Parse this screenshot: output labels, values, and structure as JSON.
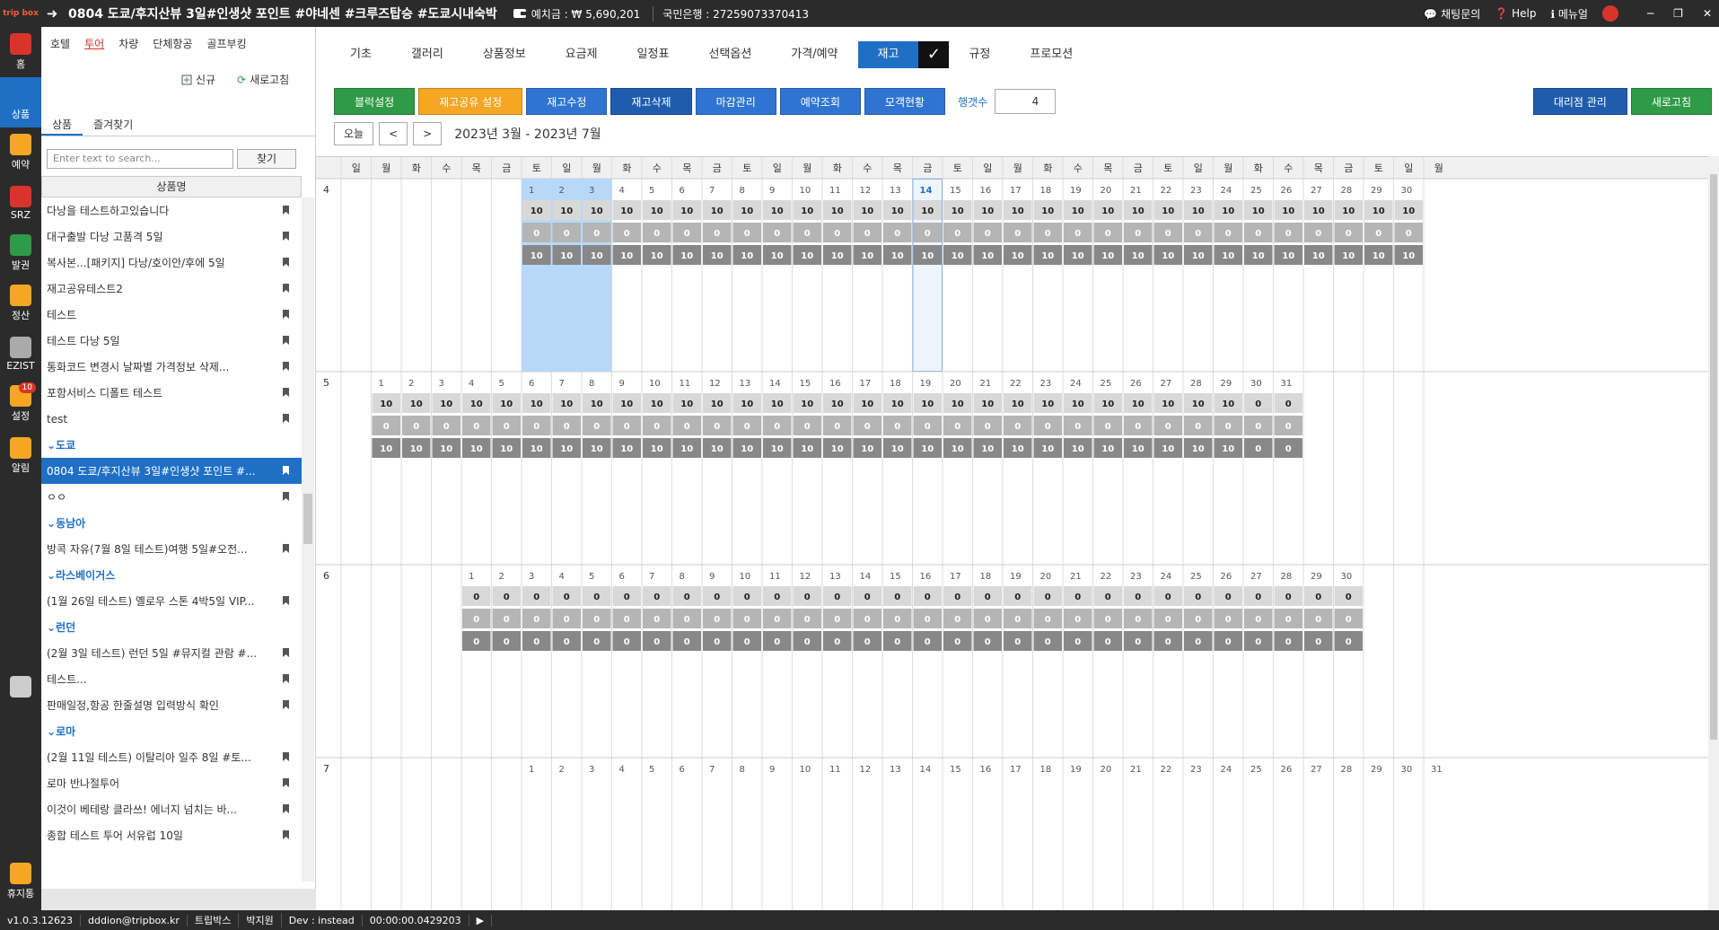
{
  "titlebar": {
    "logo": "trip box",
    "title": "0804 도쿄/후지산뷰 3일#인생샷 포인트 #야네센 #크루즈탑승 #도쿄시내숙박",
    "deposit": "예치금 : ₩ 5,690,201",
    "bank": "국민은행 : 27259073370413",
    "chat": "채팅문의",
    "help": "Help",
    "manual": "메뉴얼"
  },
  "iconbar": [
    {
      "label": "홈",
      "icon": "chart-icon"
    },
    {
      "label": "상품",
      "icon": "globe-icon"
    },
    {
      "label": "예약",
      "icon": "calendar-icon"
    },
    {
      "label": "SRZ",
      "icon": "share-icon"
    },
    {
      "label": "발권",
      "icon": "plane-icon"
    },
    {
      "label": "정산",
      "icon": "wallet-icon"
    },
    {
      "label": "EZIST",
      "icon": "network-icon"
    },
    {
      "label": "설정",
      "icon": "gear-icon",
      "badge": "10"
    },
    {
      "label": "알림",
      "icon": "chat-icon"
    },
    {
      "label": "",
      "icon": "apps-icon"
    },
    {
      "label": "휴지통",
      "icon": "trash-icon"
    }
  ],
  "leftpanel": {
    "tabs": [
      "호텔",
      "투어",
      "차량",
      "단체항공",
      "골프부킹"
    ],
    "new_label": "신규",
    "refresh_label": "새로고침",
    "subtabs": [
      "상품",
      "즐겨찾기"
    ],
    "search_placeholder": "Enter text to search...",
    "search_button": "찾기",
    "list_header": "상품명",
    "items": [
      {
        "type": "item",
        "text": "다낭을 테스트하고있습니다"
      },
      {
        "type": "item",
        "text": "대구출발 다낭 고품격 5일"
      },
      {
        "type": "item",
        "text": "복사본...[패키지] 다낭/호이안/후에 5일"
      },
      {
        "type": "item",
        "text": "재고공유테스트2"
      },
      {
        "type": "item",
        "text": "테스트"
      },
      {
        "type": "item",
        "text": "테스트 다낭 5일"
      },
      {
        "type": "item",
        "text": "통화코드 변경시 날짜별 가격정보 삭제..."
      },
      {
        "type": "item",
        "text": "포함서비스 디폴트 테스트"
      },
      {
        "type": "item",
        "text": "test"
      },
      {
        "type": "group",
        "text": "도쿄"
      },
      {
        "type": "item",
        "text": "0804 도쿄/후지산뷰 3일#인생샷 포인트 #...",
        "selected": true
      },
      {
        "type": "item",
        "text": "ㅇㅇ"
      },
      {
        "type": "group",
        "text": "동남아"
      },
      {
        "type": "item",
        "text": "방콕 자유(7월 8일 테스트)여행 5일#오전..."
      },
      {
        "type": "group",
        "text": "라스베이거스"
      },
      {
        "type": "item",
        "text": "(1월 26일 테스트) 옐로우 스톤 4박5일 VIP..."
      },
      {
        "type": "group",
        "text": "런던"
      },
      {
        "type": "item",
        "text": "(2월 3일 테스트) 런던 5일 #뮤지컬 관람 #..."
      },
      {
        "type": "item",
        "text": "테스트..."
      },
      {
        "type": "item",
        "text": "판매일정,항공 한줄설명 입력방식 확인"
      },
      {
        "type": "group",
        "text": "로마"
      },
      {
        "type": "item",
        "text": "(2월 11일 테스트) 이탈리아 일주 8일 #토..."
      },
      {
        "type": "item",
        "text": "로마 반나절투어"
      },
      {
        "type": "item",
        "text": "이것이 베테랑 클라쓰! 에너지 넘치는 바..."
      },
      {
        "type": "item",
        "text": "종합 테스트 투어 서유럽 10일"
      }
    ]
  },
  "main": {
    "tabs": [
      "기초",
      "갤러리",
      "상품정보",
      "요금제",
      "일정표",
      "선택옵션",
      "가격/예약",
      "재고",
      "규정",
      "프로모션"
    ],
    "active_tab": "재고",
    "toolbar": [
      {
        "label": "블럭설정",
        "color": "green"
      },
      {
        "label": "재고공유 설정",
        "color": "orange"
      },
      {
        "label": "재고수정",
        "color": "blue"
      },
      {
        "label": "재고삭제",
        "color": "dark"
      },
      {
        "label": "마감관리",
        "color": "blue"
      },
      {
        "label": "예약조회",
        "color": "blue"
      },
      {
        "label": "모객현황",
        "color": "blue"
      }
    ],
    "rowcount_label": "행갯수",
    "rowcount_value": "4",
    "right_buttons": [
      {
        "label": "대리점 관리",
        "color": "dark"
      },
      {
        "label": "새로고침",
        "color": "green"
      }
    ],
    "today_label": "오늘",
    "prev_label": "<",
    "next_label": ">",
    "period": "2023년 3월 - 2023년 7월"
  },
  "calendar": {
    "weekdays": [
      "일",
      "월",
      "화",
      "수",
      "목",
      "금",
      "토",
      "일",
      "월",
      "화",
      "수",
      "목",
      "금",
      "토",
      "일",
      "월",
      "화",
      "수",
      "목",
      "금",
      "토",
      "일",
      "월",
      "화",
      "수",
      "목",
      "금",
      "토",
      "일",
      "월",
      "화",
      "수",
      "목",
      "금",
      "토",
      "일",
      "월"
    ],
    "months": [
      {
        "label": "4",
        "start": 6,
        "days": 30,
        "rows": [
          10,
          0,
          10
        ],
        "today": 14,
        "highlight": [
          1,
          2,
          3
        ]
      },
      {
        "label": "5",
        "start": 1,
        "days": 31,
        "rows": [
          10,
          0,
          10
        ],
        "zero_after": 30
      },
      {
        "label": "6",
        "start": 4,
        "days": 30,
        "rows": [
          0,
          0,
          0
        ]
      },
      {
        "label": "7",
        "start": 6,
        "days": 31,
        "rows": []
      }
    ]
  },
  "statusbar": [
    "v1.0.3.12623",
    "dddion@tripbox.kr",
    "트립박스",
    "박지원",
    "Dev : instead",
    "00:00:00.0429203"
  ]
}
